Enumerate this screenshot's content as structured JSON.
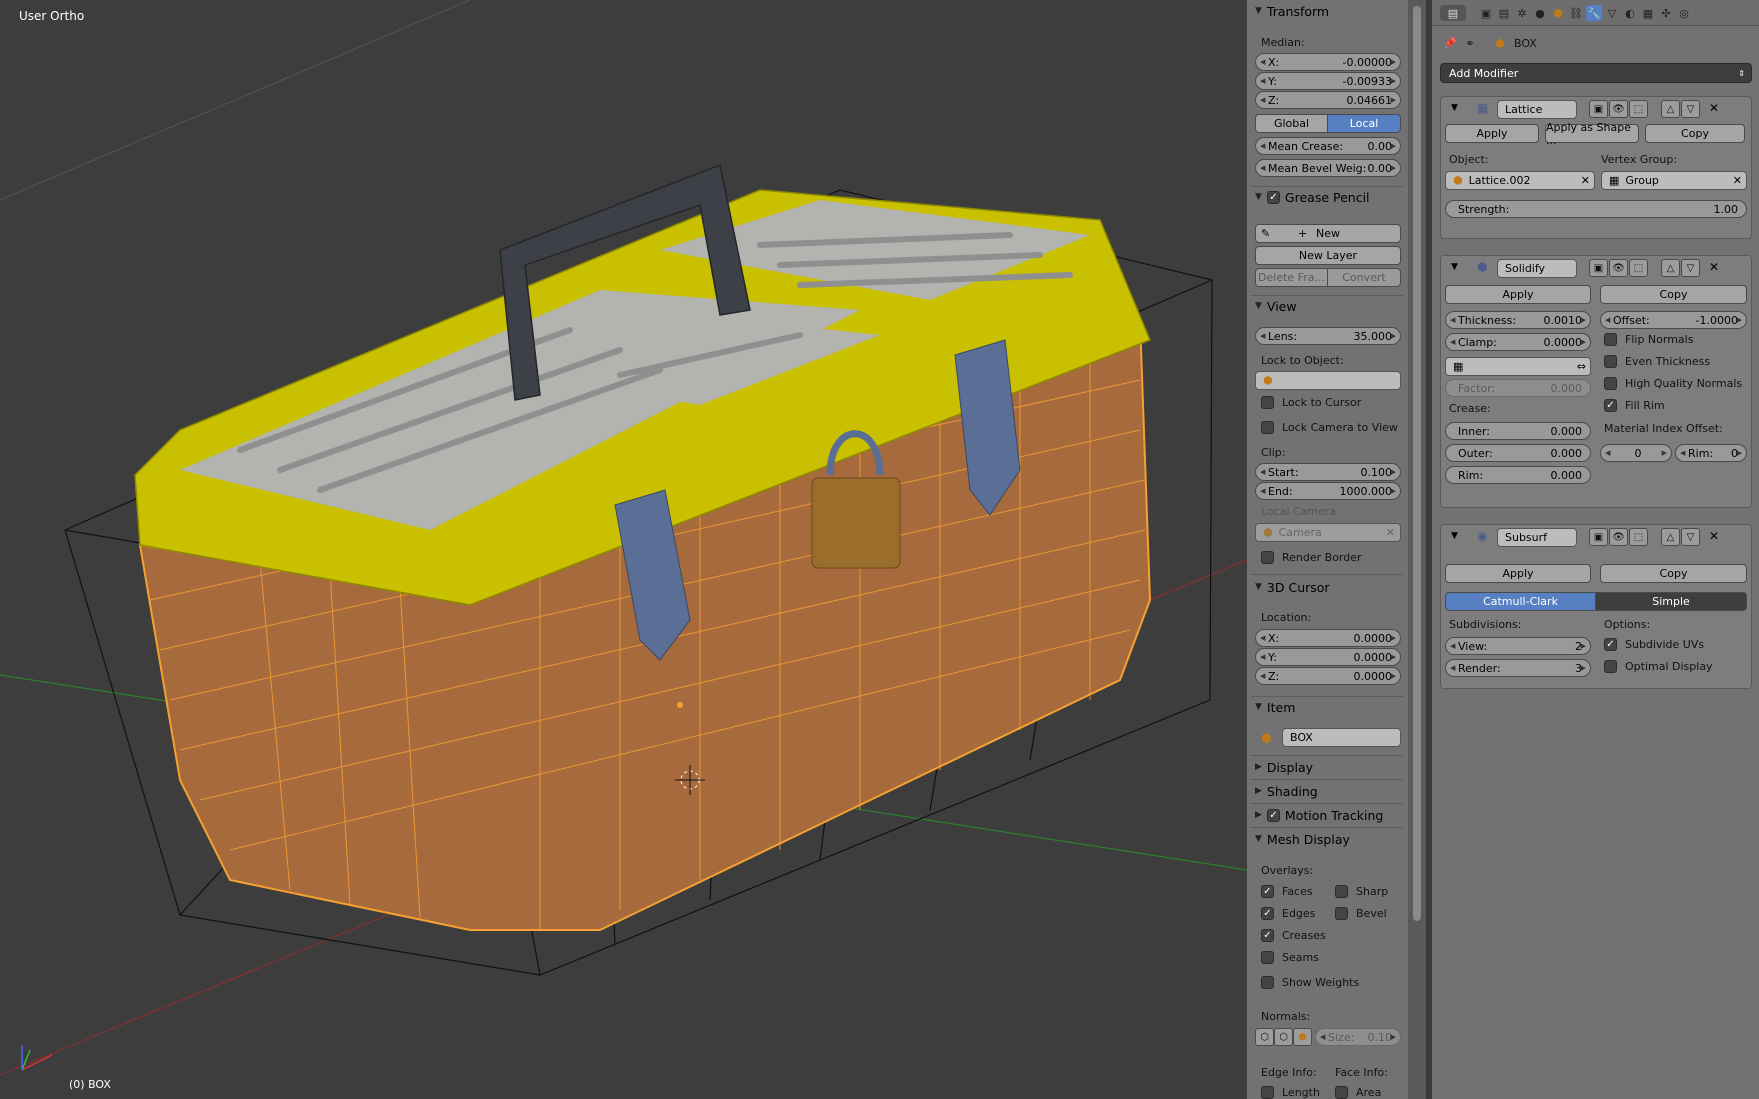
{
  "viewport": {
    "view_name": "User Ortho",
    "object_label": "(0) BOX"
  },
  "transform": {
    "title": "Transform",
    "median_label": "Median:",
    "x": {
      "label": "X:",
      "value": "-0.00000"
    },
    "y": {
      "label": "Y:",
      "value": "-0.00933"
    },
    "z": {
      "label": "Z:",
      "value": "0.04661"
    },
    "global_label": "Global",
    "local_label": "Local",
    "mean_crease": {
      "label": "Mean Crease:",
      "value": "0.00"
    },
    "mean_bevel": {
      "label": "Mean Bevel Weig:",
      "value": "0.00"
    }
  },
  "grease_pencil": {
    "title": "Grease Pencil",
    "new_label": "New",
    "new_layer_label": "New Layer",
    "delete_frame_label": "Delete Fra...",
    "convert_label": "Convert"
  },
  "view": {
    "title": "View",
    "lens": {
      "label": "Lens:",
      "value": "35.000"
    },
    "lock_to_object_label": "Lock to Object:",
    "lock_to_cursor_label": "Lock to Cursor",
    "lock_camera_label": "Lock Camera to View",
    "clip_label": "Clip:",
    "clip_start": {
      "label": "Start:",
      "value": "0.100"
    },
    "clip_end": {
      "label": "End:",
      "value": "1000.000"
    },
    "local_camera_label": "Local Camera:",
    "camera_value": "Camera",
    "render_border_label": "Render Border"
  },
  "cursor3d": {
    "title": "3D Cursor",
    "location_label": "Location:",
    "x": {
      "label": "X:",
      "value": "0.0000"
    },
    "y": {
      "label": "Y:",
      "value": "0.0000"
    },
    "z": {
      "label": "Z:",
      "value": "0.0000"
    }
  },
  "item": {
    "title": "Item",
    "name": "BOX"
  },
  "collapsed_sections": {
    "display": "Display",
    "shading": "Shading",
    "motion_tracking": "Motion Tracking"
  },
  "mesh_display": {
    "title": "Mesh Display",
    "overlays_label": "Overlays:",
    "faces": "Faces",
    "sharp": "Sharp",
    "edges": "Edges",
    "bevel": "Bevel",
    "creases": "Creases",
    "seams": "Seams",
    "show_weights": "Show Weights",
    "normals_label": "Normals:",
    "size": {
      "label": "Size:",
      "value": "0.10"
    },
    "edge_info_label": "Edge Info:",
    "face_info_label": "Face Info:",
    "length": "Length",
    "area": "Area"
  },
  "properties": {
    "object_name": "BOX",
    "add_modifier_label": "Add Modifier",
    "lattice": {
      "name": "Lattice",
      "apply": "Apply",
      "apply_shape": "Apply as Shape ...",
      "copy": "Copy",
      "object_label": "Object:",
      "object_value": "Lattice.002",
      "vertex_group_label": "Vertex Group:",
      "vertex_group_value": "Group",
      "strength": {
        "label": "Strength:",
        "value": "1.00"
      }
    },
    "solidify": {
      "name": "Solidify",
      "apply": "Apply",
      "copy": "Copy",
      "thickness": {
        "label": "Thickness:",
        "value": "0.0010"
      },
      "offset": {
        "label": "Offset:",
        "value": "-1.0000"
      },
      "clamp": {
        "label": "Clamp:",
        "value": "0.0000"
      },
      "flip_normals": "Flip Normals",
      "even_thickness": "Even Thickness",
      "high_quality_normals": "High Quality Normals",
      "factor": {
        "label": "Factor:",
        "value": "0.000"
      },
      "fill_rim": "Fill Rim",
      "crease_label": "Crease:",
      "material_index_label": "Material Index Offset:",
      "inner": {
        "label": "Inner:",
        "value": "0.000"
      },
      "outer": {
        "label": "Outer:",
        "value": "0.000"
      },
      "rim": {
        "label": "Rim:",
        "value": "0.000"
      },
      "mat_offset": "0",
      "mat_rim": {
        "label": "Rim:",
        "value": "0"
      }
    },
    "subsurf": {
      "name": "Subsurf",
      "apply": "Apply",
      "copy": "Copy",
      "catmull": "Catmull-Clark",
      "simple": "Simple",
      "subdivisions_label": "Subdivisions:",
      "options_label": "Options:",
      "view": {
        "label": "View:",
        "value": "2"
      },
      "render": {
        "label": "Render:",
        "value": "3"
      },
      "subdivide_uvs": "Subdivide UVs",
      "optimal_display": "Optimal Display"
    }
  },
  "colors": {
    "selected_wire": "#f5a030",
    "lid_yellow": "#c8c000",
    "active_button": "#5680c2"
  }
}
